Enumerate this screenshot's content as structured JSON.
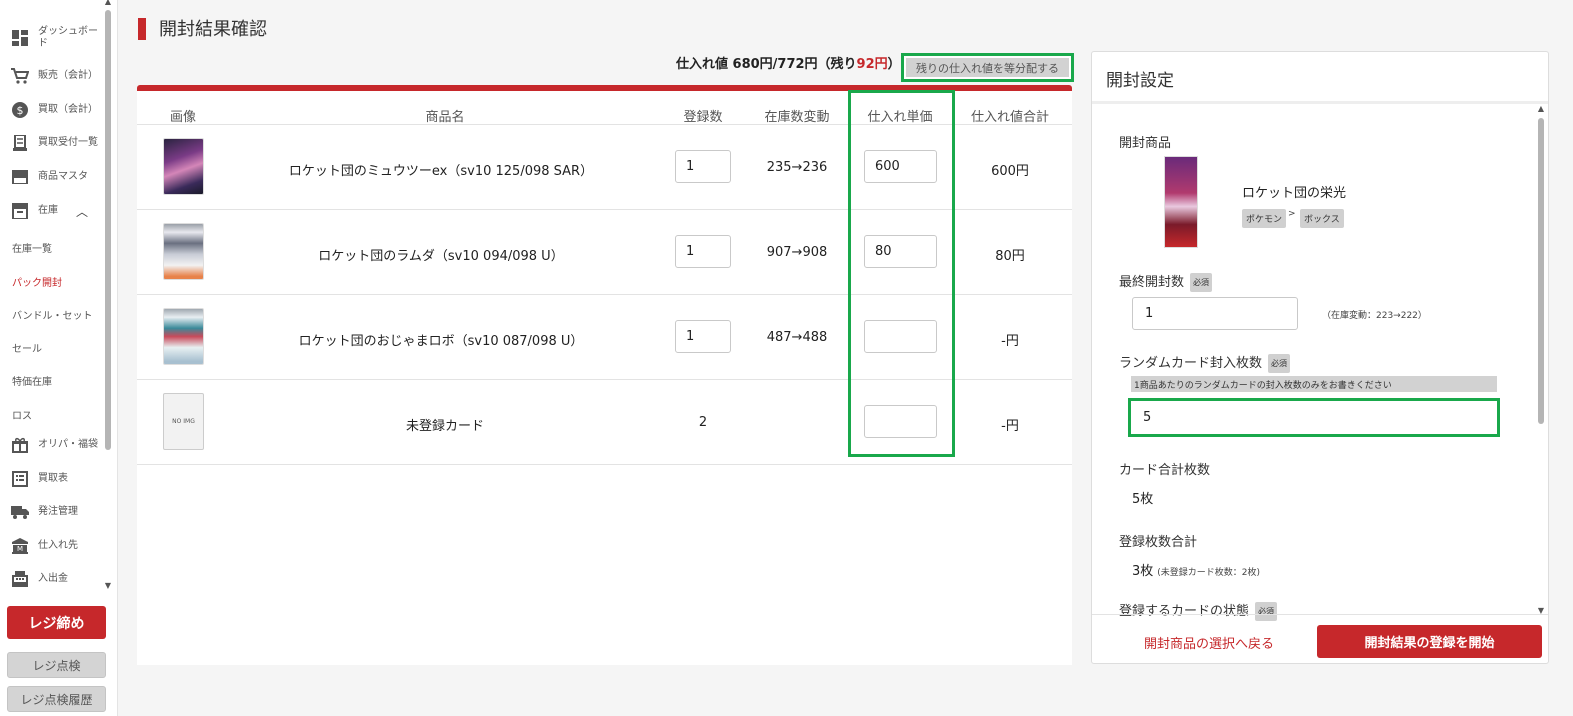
{
  "sidebar": {
    "items": [
      {
        "label": "ダッシュボード",
        "icon": "dashboard-icon"
      },
      {
        "label": "販売（会計）",
        "icon": "cart-icon"
      },
      {
        "label": "買取（会計）",
        "icon": "dollar-icon"
      },
      {
        "label": "買取受付一覧",
        "icon": "receipt-icon"
      },
      {
        "label": "商品マスタ",
        "icon": "store-icon"
      },
      {
        "label": "在庫",
        "icon": "archive-icon"
      },
      {
        "label": "オリパ・福袋",
        "icon": "gift-icon"
      },
      {
        "label": "買取表",
        "icon": "list-icon"
      },
      {
        "label": "発注管理",
        "icon": "truck-icon"
      },
      {
        "label": "仕入れ先",
        "icon": "bank-icon"
      },
      {
        "label": "入出金",
        "icon": "register-icon"
      }
    ],
    "sub_items": [
      "在庫一覧",
      "パック開封",
      "バンドル・セット",
      "セール",
      "特価在庫",
      "ロス"
    ],
    "register_close": "レジ締め",
    "register_check": "レジ点検",
    "register_history": "レジ点検履歴"
  },
  "page": {
    "title": "開封結果確認"
  },
  "summary": {
    "prefix": "仕入れ値 680円/772円（残り",
    "remaining": "92円",
    "suffix": "）",
    "equal_distribute_button": "残りの仕入れ値を等分配する"
  },
  "table": {
    "headers": [
      "画像",
      "商品名",
      "登録数",
      "在庫数変動",
      "仕入れ単価",
      "仕入れ値合計"
    ],
    "rows": [
      {
        "name": "ロケット団のミュウツーex（sv10 125/098 SAR）",
        "qty": "1",
        "stock": "235→236",
        "unit_price": "600",
        "total": "600円"
      },
      {
        "name": "ロケット団のラムダ（sv10 094/098 U）",
        "qty": "1",
        "stock": "907→908",
        "unit_price": "80",
        "total": "80円"
      },
      {
        "name": "ロケット団のおじゃまロボ（sv10 087/098 U）",
        "qty": "1",
        "stock": "487→488",
        "unit_price": "",
        "total": "-円"
      },
      {
        "name": "未登録カード",
        "qty": "2",
        "stock": "",
        "unit_price": "",
        "total": "-円"
      }
    ],
    "no_img": "NO IMG"
  },
  "panel": {
    "title": "開封設定",
    "product_label": "開封商品",
    "product_name": "ロケット団の栄光",
    "tags": [
      "ポケモン",
      "ボックス"
    ],
    "tag_sep": ">",
    "required": "必須",
    "final_open_label": "最終開封数",
    "final_open_value": "1",
    "stock_change_note": "（在庫変動：223→222）",
    "random_label": "ランダムカード封入枚数",
    "random_hint": "1商品あたりのランダムカードの封入枚数のみをお書きください",
    "random_value": "5",
    "card_total_label": "カード合計枚数",
    "card_total_value": "5枚",
    "registered_total_label": "登録枚数合計",
    "registered_total_value": "3枚",
    "registered_total_note": "(未登録カード枚数：2枚)",
    "condition_label": "登録するカードの状態",
    "back_link": "開封商品の選択へ戻る",
    "start_button": "開封結果の登録を開始"
  }
}
